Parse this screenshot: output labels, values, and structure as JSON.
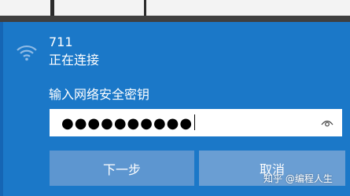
{
  "network": {
    "name": "711",
    "status": "正在连接",
    "icon": "wifi-icon"
  },
  "password": {
    "label": "输入网络安全密钥",
    "masked_value": "●●●●●●●●●●",
    "reveal_icon": "eye-icon"
  },
  "buttons": {
    "next": "下一步",
    "cancel": "取消"
  },
  "watermark": "知乎 @编程人生",
  "colors": {
    "panel_background": "#1b78c8",
    "button_background": "#5d96d0",
    "input_background": "#ffffff",
    "text": "#ffffff"
  }
}
